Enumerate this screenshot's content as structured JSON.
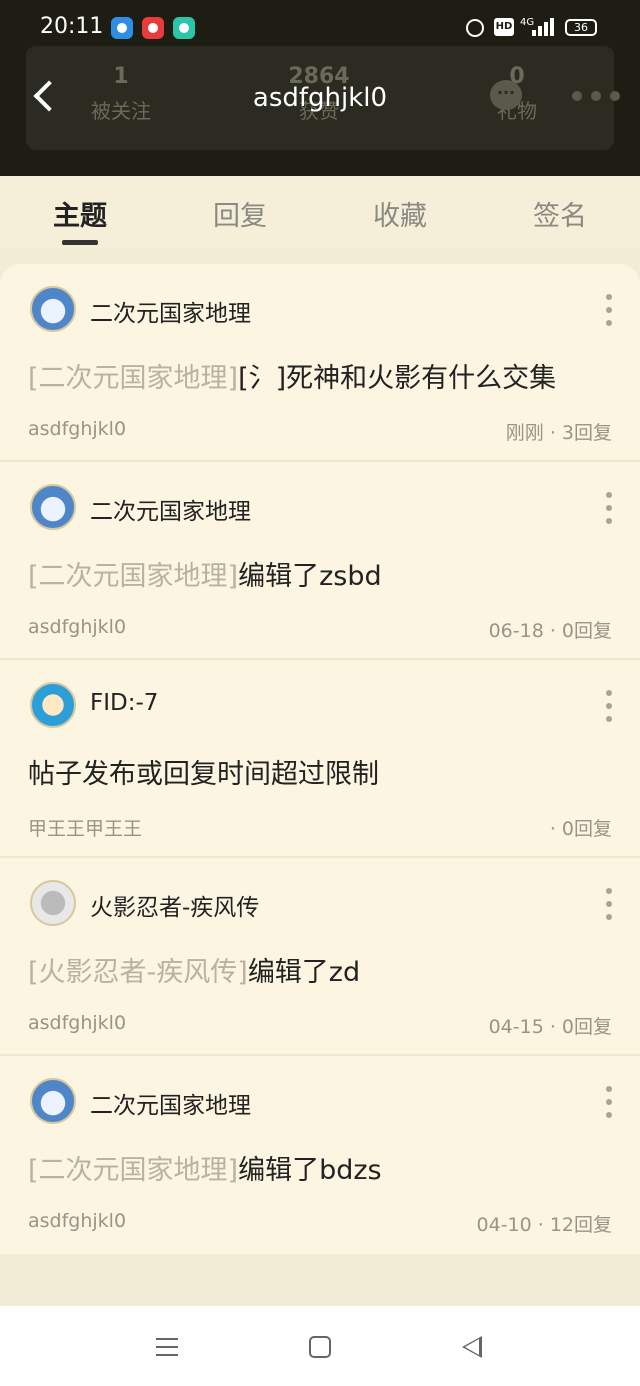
{
  "status_bar": {
    "time": "20:11",
    "hd": "HD",
    "network": "4G",
    "battery": "36"
  },
  "header": {
    "title": "asdfghjkl0",
    "stats": [
      {
        "num": "1",
        "label": "被关注"
      },
      {
        "num": "2864",
        "label": "获赞"
      },
      {
        "num": "0",
        "label": "礼物"
      }
    ]
  },
  "tabs": [
    {
      "label": "主题",
      "active": true
    },
    {
      "label": "回复",
      "active": false
    },
    {
      "label": "收藏",
      "active": false
    },
    {
      "label": "签名",
      "active": false
    }
  ],
  "posts": [
    {
      "forum": "二次元国家地理",
      "tag": "[二次元国家地理]",
      "title": "[氵]死神和火影有什么交集",
      "author": "asdfghjkl0",
      "meta": "刚刚 · 3回复",
      "avatar": "tiger"
    },
    {
      "forum": "二次元国家地理",
      "tag": "[二次元国家地理]",
      "title": "编辑了zsbd",
      "author": "asdfghjkl0",
      "meta": "06-18  · 0回复",
      "avatar": "tiger"
    },
    {
      "forum": "FID:-7",
      "tag": "",
      "title": "帖子发布或回复时间超过限制",
      "author": "甲王王甲王王",
      "meta": "· 0回复",
      "avatar": "thumb"
    },
    {
      "forum": "火影忍者-疾风传",
      "tag": "[火影忍者-疾风传]",
      "title": "编辑了zd",
      "author": "asdfghjkl0",
      "meta": "04-15  · 0回复",
      "avatar": "robot"
    },
    {
      "forum": "二次元国家地理",
      "tag": "[二次元国家地理]",
      "title": "编辑了bdzs",
      "author": "asdfghjkl0",
      "meta": "04-10  · 12回复",
      "avatar": "tiger"
    }
  ]
}
